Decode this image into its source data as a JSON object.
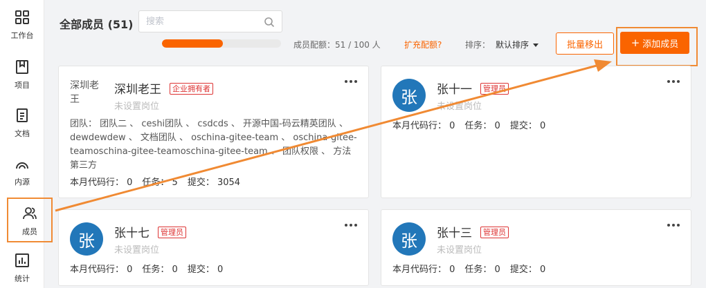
{
  "sidebar": {
    "items": [
      {
        "label": "工作台",
        "icon": "grid-icon"
      },
      {
        "label": "项目",
        "icon": "book-icon"
      },
      {
        "label": "文档",
        "icon": "document-icon"
      },
      {
        "label": "内源",
        "icon": "source-icon"
      },
      {
        "label": "成员",
        "icon": "members-icon"
      },
      {
        "label": "统计",
        "icon": "chart-icon"
      }
    ],
    "active": "成员"
  },
  "header": {
    "title": "全部成员 (51)",
    "search_placeholder": "搜索",
    "quota_text": "成员配额：51 / 100 人",
    "quota_fraction": 0.51,
    "expand_link": "扩充配额?",
    "sort_label": "排序：",
    "sort_value": "默认排序",
    "remove_button": "批量移出",
    "add_button": "添加成员",
    "add_icon": "+"
  },
  "members": [
    {
      "avatar_text": "深圳老王",
      "name": "深圳老王",
      "badge": "企业拥有者",
      "position": "未设置岗位",
      "teams_text": "团队： 团队二 、 ceshi团队 、 csdcds 、 开源中国-码云精英团队 、 dewdewdew 、 文档团队 、 oschina-gitee-team 、 oschina-gitee-teamoschina-gitee-teamoschina-gitee-team 、 团队权限 、 方法第三方",
      "code_lines": "本月代码行： 0",
      "tasks": "任务： 5",
      "commits": "提交： 3054"
    },
    {
      "avatar_text": "张",
      "name": "张十一",
      "badge": "管理员",
      "position": "未设置岗位",
      "code_lines": "本月代码行： 0",
      "tasks": "任务： 0",
      "commits": "提交： 0"
    },
    {
      "avatar_text": "张",
      "name": "张十七",
      "badge": "管理员",
      "position": "未设置岗位",
      "code_lines": "本月代码行： 0",
      "tasks": "任务： 0",
      "commits": "提交： 0"
    },
    {
      "avatar_text": "张",
      "name": "张十三",
      "badge": "管理员",
      "position": "未设置岗位",
      "code_lines": "本月代码行： 0",
      "tasks": "任务： 0",
      "commits": "提交： 0"
    }
  ],
  "colors": {
    "accent": "#fa6400",
    "avatar": "#2277b9",
    "annotation": "#f08a33",
    "badge": "#dd3333"
  }
}
